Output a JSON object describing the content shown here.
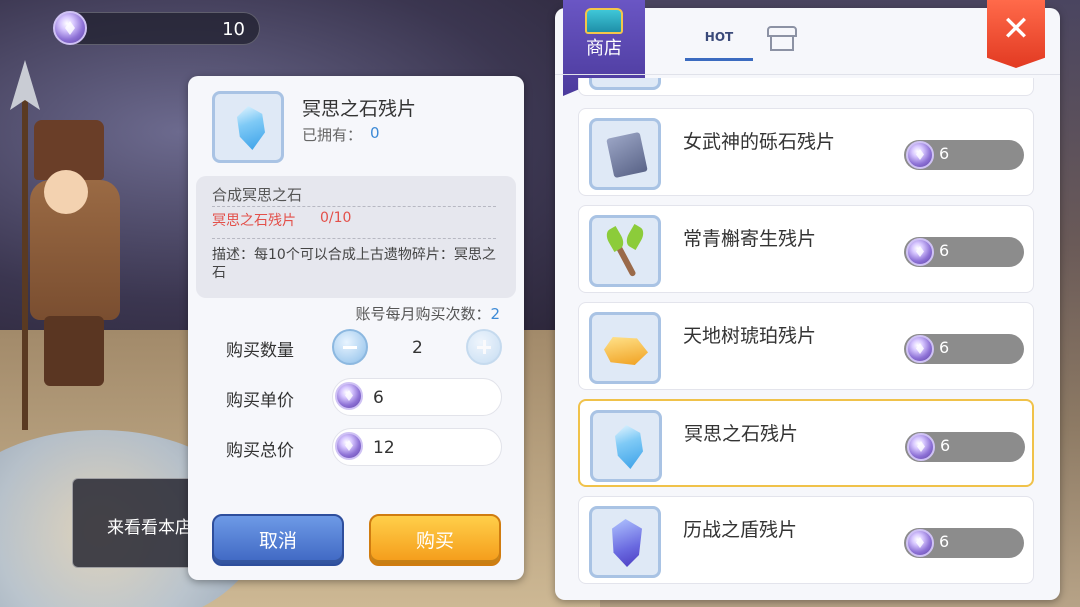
{
  "currency": {
    "icon": "gem-coin-icon",
    "amount": "10"
  },
  "tooltip": {
    "text": "来看看本店"
  },
  "dialog": {
    "item_name": "冥思之石残片",
    "owned_label": "已拥有：",
    "owned_value": "0",
    "combine_title": "合成冥思之石",
    "material_name": "冥思之石残片",
    "material_count": "0/10",
    "description": "描述：每10个可以合成上古遗物碎片：冥思之石",
    "monthly_limit_label": "账号每月购买次数：",
    "monthly_limit_value": "2",
    "quantity_label": "购买数量",
    "quantity_value": "2",
    "unit_price_label": "购买单价",
    "unit_price_value": "6",
    "total_price_label": "购买总价",
    "total_price_value": "12",
    "cancel_label": "取消",
    "buy_label": "购买"
  },
  "shop": {
    "banner_label": "商店",
    "tabs": [
      {
        "label": "HOT",
        "active": true
      },
      {
        "label": "",
        "icon": "store-icon",
        "active": false
      }
    ],
    "close_icon": "close-icon",
    "items": [
      {
        "name": "女武神的砾石残片",
        "price": "6",
        "icon": "book-icon",
        "selected": false
      },
      {
        "name": "常青槲寄生残片",
        "price": "6",
        "icon": "twig-icon",
        "selected": false
      },
      {
        "name": "天地树琥珀残片",
        "price": "6",
        "icon": "amber-icon",
        "selected": false
      },
      {
        "name": "冥思之石残片",
        "price": "6",
        "icon": "crystal-icon",
        "selected": true
      },
      {
        "name": "历战之盾残片",
        "price": "6",
        "icon": "shield-crystal-icon",
        "selected": false
      }
    ]
  },
  "colors": {
    "accent_blue": "#3d8ad6",
    "material_red": "#e3504a",
    "selected_border": "#f0c24a",
    "close_red": "#e23a22"
  }
}
